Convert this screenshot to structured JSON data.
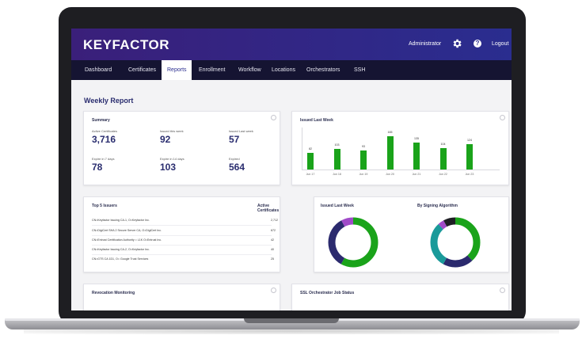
{
  "app": {
    "logo": "KEYFACTOR",
    "user": "Administrator",
    "logout": "Logout",
    "help_glyph": "?"
  },
  "nav": {
    "items": [
      {
        "label": "Dashboard",
        "active": false
      },
      {
        "label": "Certificates",
        "active": false
      },
      {
        "label": "Reports",
        "active": true
      },
      {
        "label": "Enrollment",
        "active": false
      },
      {
        "label": "Workflow",
        "active": false
      },
      {
        "label": "Locations",
        "active": false
      },
      {
        "label": "Orchestrators",
        "active": false
      },
      {
        "label": "SSH",
        "active": false
      }
    ]
  },
  "page": {
    "title": "Weekly Report"
  },
  "summary": {
    "title": "Summary",
    "stats": [
      {
        "label": "Active Certificates",
        "value": "3,716"
      },
      {
        "label": "Issued this week",
        "value": "92"
      },
      {
        "label": "Issued Last week",
        "value": "57"
      },
      {
        "label": "Expire in 7 days",
        "value": "78"
      },
      {
        "label": "Expire in 14 days",
        "value": "103"
      },
      {
        "label": "Expired",
        "value": "564"
      }
    ]
  },
  "issued_chart_card": {
    "title": "Issued Last Week"
  },
  "top_issuers": {
    "title": "Top 5 Issuers",
    "col_header": "Active Certificates",
    "rows": [
      {
        "name": "CN=Keyfactor Issuing CA-1, O=Keyfactor Inc.",
        "value": "2,712"
      },
      {
        "name": "CN=DigiCert SHA 2 Secure Server CA, O=DigiCert Inc.",
        "value": "672"
      },
      {
        "name": "CN=Entrust Certification Authority = L1K O=Entrust Inc.",
        "value": "42"
      },
      {
        "name": "CN=Keyfactor Issuing CA-2, O=Keyfactor Inc.",
        "value": "40"
      },
      {
        "name": "CN=GTS CA 1D1, O= Google Trust Services",
        "value": "25"
      }
    ]
  },
  "donuts_card": {
    "left_title": "Issued Last Week",
    "right_title": "By Signing Algorithm"
  },
  "revocation": {
    "title": "Revocation Monitoring"
  },
  "ssl_orchestrator": {
    "title": "SSL Orchestrator Job Status"
  },
  "colors": {
    "accent": "#2a2d8f",
    "bar": "#1aa31a",
    "donut_green": "#1aa31a",
    "donut_navy": "#2b2a6e",
    "donut_purple": "#a04ac8",
    "donut_teal": "#1a9a9a"
  },
  "icons": [
    "gear-icon",
    "help-icon",
    "settings-icon"
  ],
  "chart_data": [
    {
      "type": "bar",
      "title": "Issued Last Week",
      "categories": [
        "Jun 17",
        "Jun 18",
        "Jun 19",
        "Jun 20",
        "Jun 21",
        "Jun 22",
        "Jun 23"
      ],
      "values": [
        82,
        103,
        93,
        165,
        135,
        104,
        124
      ],
      "ylim": [
        0,
        180
      ]
    },
    {
      "type": "pie",
      "title": "Issued Last Week",
      "slices": [
        {
          "color": "#1aa31a",
          "value": 58
        },
        {
          "color": "#2b2a6e",
          "value": 34
        },
        {
          "color": "#a04ac8",
          "value": 8
        }
      ]
    },
    {
      "type": "pie",
      "title": "By Signing Algorithm",
      "slices": [
        {
          "color": "#1aa31a",
          "value": 38
        },
        {
          "color": "#2b2a6e",
          "value": 20
        },
        {
          "color": "#1a9a9a",
          "value": 30
        },
        {
          "color": "#a04ac8",
          "value": 4
        },
        {
          "color": "#1e1e24",
          "value": 8
        }
      ]
    }
  ]
}
